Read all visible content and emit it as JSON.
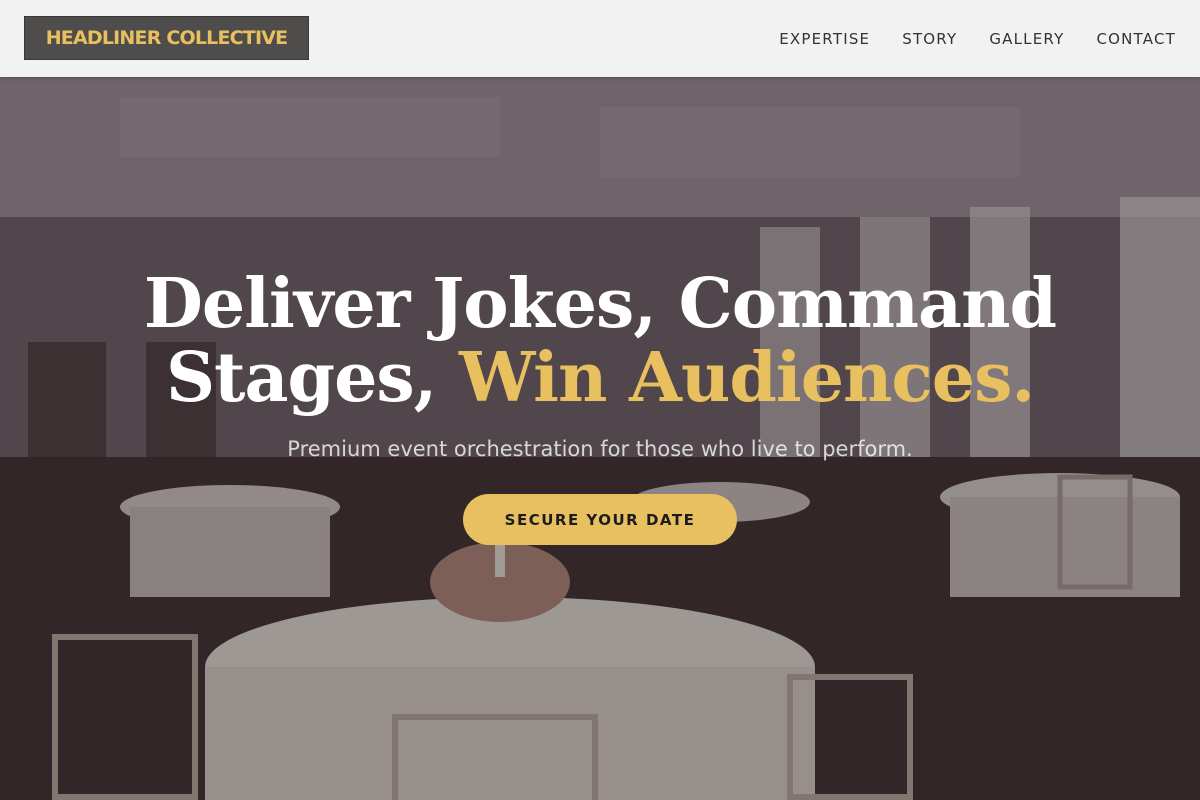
{
  "brand": {
    "name": "HEADLINER COLLECTIVE",
    "accent_color": "#e8c060"
  },
  "nav": {
    "links": [
      "EXPERTISE",
      "STORY",
      "GALLERY",
      "CONTACT"
    ]
  },
  "hero": {
    "headline_line1": "Deliver Jokes, Command",
    "headline_line2_plain": "Stages,",
    "headline_line2_accent": "Win Audiences.",
    "subtitle": "Premium event orchestration for those who live to perform.",
    "cta_label": "SECURE YOUR DATE"
  }
}
